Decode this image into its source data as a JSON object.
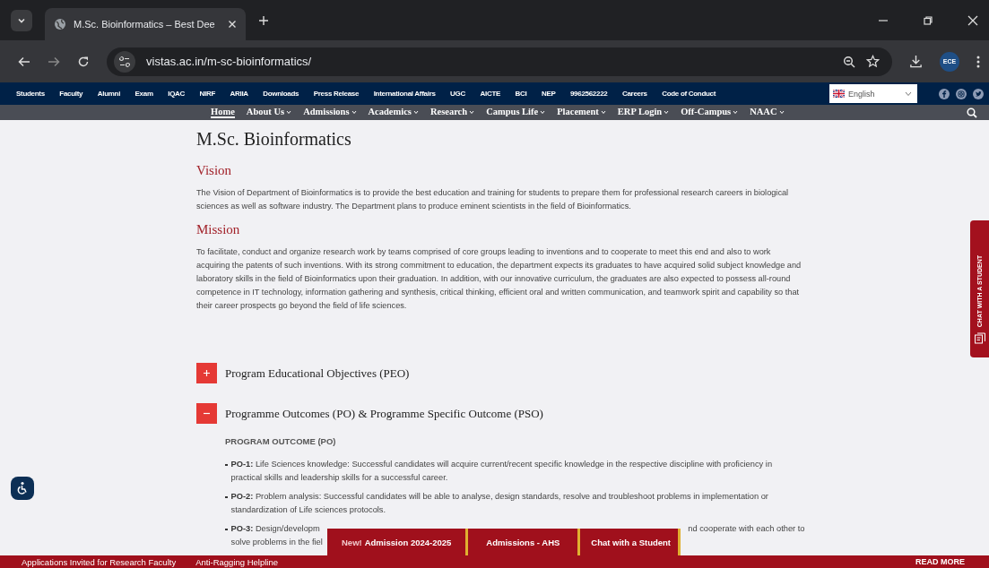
{
  "browser": {
    "tab_title": "M.Sc. Bioinformatics – Best Dee",
    "url": "vistas.ac.in/m-sc-bioinformatics/",
    "profile": "ECE"
  },
  "top_links": [
    "Students",
    "Faculty",
    "Alumni",
    "Exam",
    "IQAC",
    "NIRF",
    "ARIIA",
    "Downloads",
    "Press Release",
    "International Affairs",
    "UGC",
    "AICTE",
    "BCI",
    "NEP",
    "9962562222",
    "Careers",
    "Code of Conduct"
  ],
  "language": "English",
  "nav": [
    {
      "label": "Home",
      "selected": true,
      "dropdown": false
    },
    {
      "label": "About Us",
      "selected": false,
      "dropdown": true
    },
    {
      "label": "Admissions",
      "selected": false,
      "dropdown": true
    },
    {
      "label": "Academics",
      "selected": false,
      "dropdown": true
    },
    {
      "label": "Research",
      "selected": false,
      "dropdown": true
    },
    {
      "label": "Campus Life",
      "selected": false,
      "dropdown": true
    },
    {
      "label": "Placement",
      "selected": false,
      "dropdown": true
    },
    {
      "label": "ERP Login",
      "selected": false,
      "dropdown": true
    },
    {
      "label": "Off-Campus",
      "selected": false,
      "dropdown": true
    },
    {
      "label": "NAAC",
      "selected": false,
      "dropdown": true
    }
  ],
  "page": {
    "title": "M.Sc. Bioinformatics",
    "sections": [
      {
        "heading": "Vision",
        "text": "The Vision of Department of Bioinformatics is to provide the best education and training for students to prepare them for professional research careers in biological sciences as well as software industry. The Department plans to produce eminent scientists in the field of Bioinformatics."
      },
      {
        "heading": "Mission",
        "text": "To facilitate, conduct and organize research work by teams comprised of core groups leading to inventions and to cooperate to meet this end and also to work acquiring the patents of such inventions. With its strong commitment to education, the department expects its graduates to have acquired solid subject knowledge and laboratory skills in the field of Bioinformatics upon their graduation. In addition, with our innovative curriculum, the graduates are also expected to possess all-round competence in IT technology, information gathering and synthesis, critical thinking, efficient oral and written communication, and teamwork spirit and capability so that their career prospects go beyond the field of life sciences."
      }
    ],
    "accordions": [
      {
        "title": "Program Educational Objectives (PEO)",
        "expanded": false
      },
      {
        "title": "Programme Outcomes (PO) & Programme Specific Outcome (PSO)",
        "expanded": true
      }
    ],
    "outcome_heading": "PROGRAM OUTCOME (PO)",
    "outcomes": [
      {
        "label": "PO-1:",
        "text": "Life Sciences knowledge: Successful candidates will acquire current/recent specific knowledge in the respective discipline with proficiency in practical skills and leadership skills for a successful career."
      },
      {
        "label": "PO-2:",
        "text": "Problem analysis: Successful candidates will be able to analyse, design standards, resolve and troubleshoot problems in implementation or standardization of Life sciences protocols."
      }
    ],
    "partial_outcome": {
      "label": "PO-3:",
      "text_start": "Design/developm",
      "text_end": "nd cooperate with each other to",
      "line_2": "solve problems in the fiel"
    }
  },
  "bottom_tabs": [
    {
      "badge": "New!",
      "label": "Admission 2024-2025"
    },
    {
      "label": "Admissions - AHS"
    },
    {
      "label": "Chat with a Student"
    }
  ],
  "ticker": [
    "Applications Invited for Research Faculty",
    "Anti-Ragging Helpline"
  ],
  "read_more": "READ MORE",
  "side_tab": "CHAT WITH A STUDENT"
}
